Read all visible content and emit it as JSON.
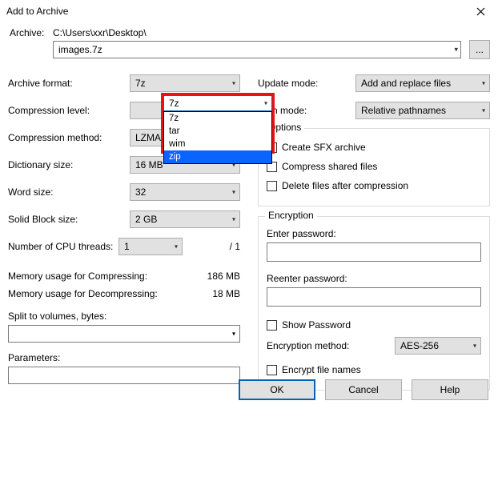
{
  "window": {
    "title": "Add to Archive"
  },
  "archive": {
    "label": "Archive:",
    "path": "C:\\Users\\xxr\\Desktop\\",
    "filename": "images.7z",
    "browse": "..."
  },
  "left": {
    "format_label": "Archive format:",
    "format_value": "7z",
    "format_options": [
      "7z",
      "tar",
      "wim",
      "zip"
    ],
    "format_highlighted": "zip",
    "level_label": "Compression level:",
    "method_label": "Compression method:",
    "method_value": "LZMA2",
    "dict_label": "Dictionary size:",
    "dict_value": "16 MB",
    "word_label": "Word size:",
    "word_value": "32",
    "block_label": "Solid Block size:",
    "block_value": "2 GB",
    "threads_label": "Number of CPU threads:",
    "threads_value": "1",
    "threads_total": "/ 1",
    "mem_c_label": "Memory usage for Compressing:",
    "mem_c_value": "186 MB",
    "mem_d_label": "Memory usage for Decompressing:",
    "mem_d_value": "18 MB",
    "split_label": "Split to volumes, bytes:",
    "params_label": "Parameters:"
  },
  "right": {
    "update_label": "Update mode:",
    "update_value": "Add and replace files",
    "pathmode_label": "Path mode:",
    "pathmode_value": "Relative pathnames",
    "options_title": "Options",
    "opt_sfx": "Create SFX archive",
    "opt_shared": "Compress shared files",
    "opt_delete": "Delete files after compression",
    "enc_title": "Encryption",
    "enter_pw": "Enter password:",
    "reenter_pw": "Reenter password:",
    "show_pw": "Show Password",
    "enc_method_label": "Encryption method:",
    "enc_method_value": "AES-256",
    "enc_names": "Encrypt file names"
  },
  "buttons": {
    "ok": "OK",
    "cancel": "Cancel",
    "help": "Help"
  }
}
